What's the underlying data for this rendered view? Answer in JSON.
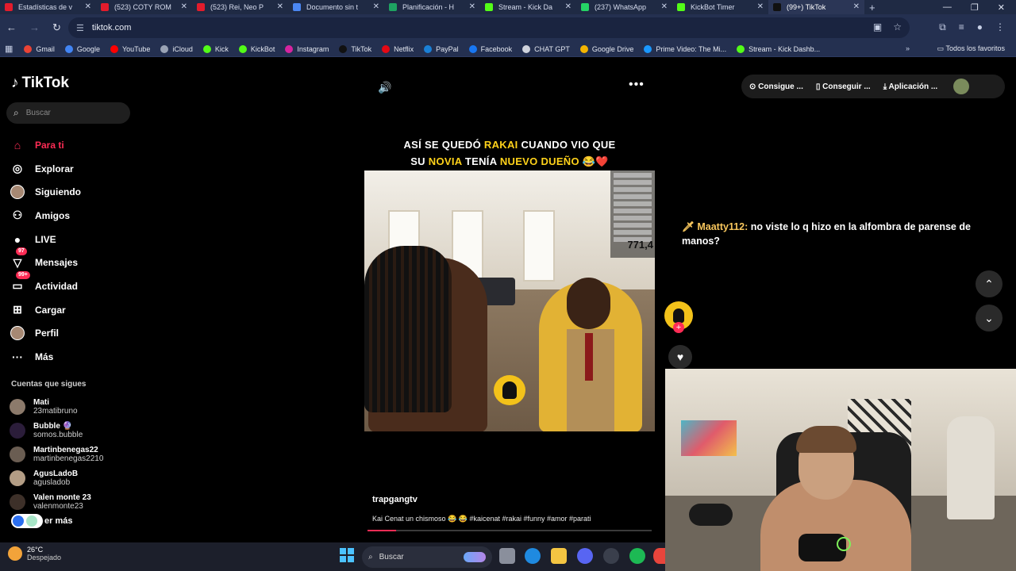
{
  "browser": {
    "tabs": [
      {
        "title": "Estadísticas de v",
        "color": "#e31c2c"
      },
      {
        "title": "(523) COTY ROM",
        "color": "#e31c2c"
      },
      {
        "title": "(523) Rei, Neo P",
        "color": "#e31c2c"
      },
      {
        "title": "Documento sin t",
        "color": "#4b87f2"
      },
      {
        "title": "Planificación - H",
        "color": "#1ea362"
      },
      {
        "title": "Stream - Kick Da",
        "color": "#53fc18"
      },
      {
        "title": "(237) WhatsApp",
        "color": "#25d366"
      },
      {
        "title": "KickBot Timer",
        "color": "#53fc18"
      },
      {
        "title": "(99+) TikTok",
        "color": "#111111",
        "active": true
      }
    ],
    "url": "tiktok.com",
    "bookmarks": [
      {
        "label": "Gmail",
        "color": "#ea4335"
      },
      {
        "label": "Google",
        "color": "#4285f4"
      },
      {
        "label": "YouTube",
        "color": "#ff0000"
      },
      {
        "label": "iCloud",
        "color": "#9aa3b5"
      },
      {
        "label": "Kick",
        "color": "#53fc18"
      },
      {
        "label": "KickBot",
        "color": "#53fc18"
      },
      {
        "label": "Instagram",
        "color": "#d6249f"
      },
      {
        "label": "TikTok",
        "color": "#111111"
      },
      {
        "label": "Netflix",
        "color": "#e50914"
      },
      {
        "label": "PayPal",
        "color": "#1a80d6"
      },
      {
        "label": "Facebook",
        "color": "#1877f2"
      },
      {
        "label": "CHAT GPT",
        "color": "#cfd3dc"
      },
      {
        "label": "Google Drive",
        "color": "#f4b400"
      },
      {
        "label": "Prime Video: The Mi...",
        "color": "#1a98ff"
      },
      {
        "label": "Stream - Kick Dashb...",
        "color": "#53fc18"
      }
    ],
    "all_bookmarks": "Todos los favoritos"
  },
  "tiktok": {
    "logo": "TikTok",
    "search_placeholder": "Buscar",
    "menu": [
      {
        "label": "Para ti",
        "icon": "home-icon",
        "glyph": "⌂",
        "active": true
      },
      {
        "label": "Explorar",
        "icon": "compass-icon",
        "glyph": "◎"
      },
      {
        "label": "Siguiendo",
        "icon": "following-avatar-icon",
        "glyph": ""
      },
      {
        "label": "Amigos",
        "icon": "friends-icon",
        "glyph": "⚇"
      },
      {
        "label": "LIVE",
        "icon": "live-icon",
        "glyph": "●"
      },
      {
        "label": "Mensajes",
        "icon": "messages-icon",
        "glyph": "▽",
        "badge": "97"
      },
      {
        "label": "Actividad",
        "icon": "activity-icon",
        "glyph": "▭",
        "badge": "99+"
      },
      {
        "label": "Cargar",
        "icon": "upload-icon",
        "glyph": "⊞"
      },
      {
        "label": "Perfil",
        "icon": "profile-icon",
        "glyph": ""
      },
      {
        "label": "Más",
        "icon": "more-icon",
        "glyph": "···"
      }
    ],
    "following_header": "Cuentas que sigues",
    "following": [
      {
        "name": "Mati",
        "handle": "23matibruno",
        "color": "#8c7a6b"
      },
      {
        "name": "Bubble 🔮",
        "handle": "somos.bubble",
        "color": "#2b1d3a"
      },
      {
        "name": "Martinbenegas22",
        "handle": "martinbenegas2210",
        "color": "#6a5d52"
      },
      {
        "name": "AgusLadoB",
        "handle": "agusladob",
        "color": "#b39d85"
      },
      {
        "name": "Valen monte 23",
        "handle": "valenmonte23",
        "color": "#3d3029"
      }
    ],
    "see_more": "er más",
    "top_buttons": [
      "Consigue ...",
      "Conseguir ...",
      "Aplicación ..."
    ],
    "video_caption_line1_a": "ASÍ SE QUEDÓ ",
    "video_caption_line1_b": "RAKAI",
    "video_caption_line1_c": " CUANDO VIO QUE",
    "video_caption_line2_a": "SU ",
    "video_caption_line2_b": "NOVIA",
    "video_caption_line2_c": " TENÍA ",
    "video_caption_line2_d": "NUEVO DUEÑO",
    "video_caption_line2_e": " 😂❤️",
    "video_overlay_count": "771,4",
    "video_user": "trapgangtv",
    "video_desc": "Kai Cenat un chismoso 😂 😂 #kaicenat #rakai #funny #amor #parati",
    "progress": 0.1
  },
  "stream_chat": {
    "user": "Maatty112:",
    "message": "no viste lo q hizo en la alfombra de parense de manos?"
  },
  "taskbar": {
    "temp": "26°C",
    "weather": "Despejado",
    "search": "Buscar"
  }
}
